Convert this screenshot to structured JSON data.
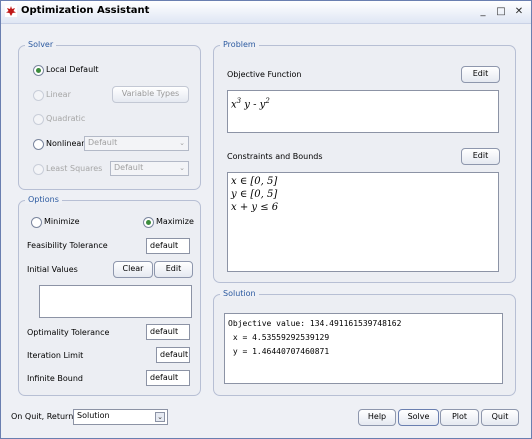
{
  "window": {
    "title": "Optimization Assistant",
    "min_glyph": "_",
    "max_glyph": "□",
    "close_glyph": "✕",
    "app_icon": "maple-leaf-icon"
  },
  "solver": {
    "legend": "Solver",
    "local_default": "Local Default",
    "linear": "Linear",
    "variable_types": "Variable Types",
    "quadratic": "Quadratic",
    "nonlinear": "Nonlinear",
    "nonlinear_method": "Default",
    "least_squares": "Least Squares",
    "least_squares_method": "Default"
  },
  "options": {
    "legend": "Options",
    "minimize": "Minimize",
    "maximize": "Maximize",
    "feasibility_label": "Feasibility Tolerance",
    "feasibility_value": "default",
    "initial_values_label": "Initial Values",
    "clear": "Clear",
    "edit": "Edit",
    "optimality_label": "Optimality Tolerance",
    "optimality_value": "default",
    "iteration_label": "Iteration Limit",
    "iteration_value": "default",
    "infinite_label": "Infinite Bound",
    "infinite_value": "default"
  },
  "problem": {
    "legend": "Problem",
    "objective_label": "Objective Function",
    "objective_edit": "Edit",
    "objective_expr": {
      "t1": "x",
      "s1": "3",
      "t2": " y - y",
      "s2": "2"
    },
    "constraints_label": "Constraints and Bounds",
    "constraints_edit": "Edit",
    "constraints": [
      "x ∈ [0, 5]",
      "y ∈ [0, 5]",
      "x + y ≤ 6"
    ]
  },
  "solution": {
    "legend": "Solution",
    "lines": [
      "Objective value: 134.491161539748162",
      " x = 4.53559292539129",
      " y = 1.46440707460871"
    ]
  },
  "footer": {
    "on_quit_label": "On Quit, Return",
    "on_quit_value": "Solution",
    "help": "Help",
    "solve": "Solve",
    "plot": "Plot",
    "quit": "Quit"
  }
}
